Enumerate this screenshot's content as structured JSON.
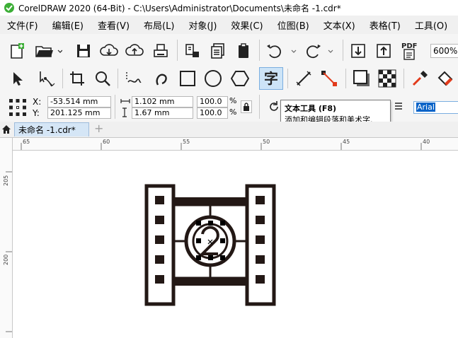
{
  "titlebar": {
    "title": "CorelDRAW 2020 (64-Bit) - C:\\Users\\Administrator\\Documents\\未命名 -1.cdr*"
  },
  "menu": [
    "文件(F)",
    "编辑(E)",
    "查看(V)",
    "布局(L)",
    "对象(J)",
    "效果(C)",
    "位图(B)",
    "文本(X)",
    "表格(T)",
    "工具(O)"
  ],
  "standard_toolbar": {
    "zoom": "600%"
  },
  "tools": [
    "pick-tool",
    "shape-tool",
    "crop-tool",
    "zoom-tool",
    "freehand-tool",
    "artistic-media-tool",
    "rectangle-tool",
    "ellipse-tool",
    "polygon-tool",
    "text-tool",
    "parallel-dimension-tool",
    "connector-tool",
    "drop-shadow-tool",
    "transparency-tool",
    "color-eyedropper-tool",
    "interactive-fill-tool"
  ],
  "property_bar": {
    "x_label": "X:",
    "x_value": "-53.514 mm",
    "y_label": "Y:",
    "y_value": "201.125 mm",
    "width_value": "1.102 mm",
    "height_value": "1.67 mm",
    "scale_x": "100.0",
    "scale_y": "100.0",
    "percent": "%",
    "font": "Arial"
  },
  "tooltip": {
    "title": "文本工具 (F8)",
    "description": "添加和编辑段落和美术字."
  },
  "document_tab": {
    "label": "未命名 -1.cdr*",
    "add_tab": "+"
  },
  "ruler": {
    "horizontal": [
      "65",
      "60",
      "55",
      "50",
      "45",
      "40"
    ],
    "vertical": [
      "205",
      "200"
    ]
  },
  "colors": {
    "accent_green": "#3cae36",
    "tab_blue": "#d5e6f6",
    "selection_blue": "#0a64c8",
    "highlight": "#cde4f7"
  }
}
